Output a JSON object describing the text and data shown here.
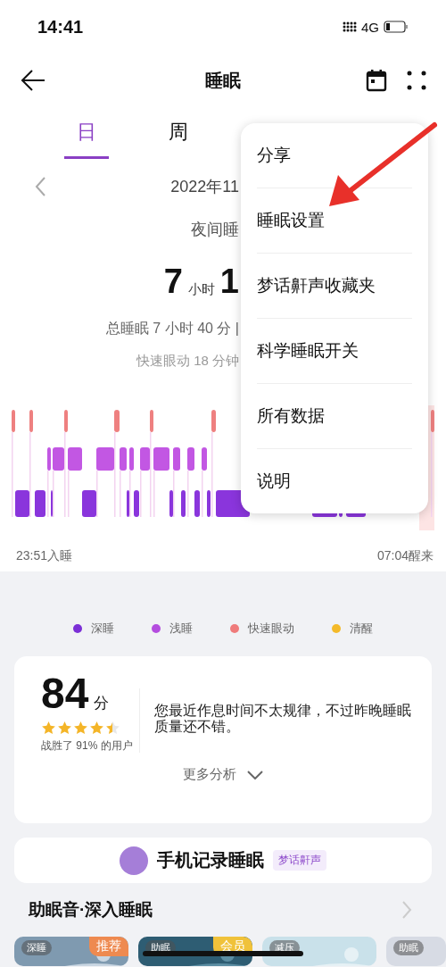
{
  "status_bar": {
    "time": "14:41",
    "network": "4G"
  },
  "header": {
    "title": "睡眠"
  },
  "tabs": [
    {
      "label": "日",
      "selected": true
    },
    {
      "label": "周",
      "selected": false
    }
  ],
  "summary": {
    "date": "2022年11",
    "label": "夜间睡",
    "hours": "7",
    "hours_unit": "小时",
    "minutes": "1",
    "total": "总睡眠 7 小时 40 分 |",
    "rem": "快速眼动 18 分钟"
  },
  "chart": {
    "start": "23:51入睡",
    "end": "07:04醒来"
  },
  "menu": [
    "分享",
    "睡眠设置",
    "梦话鼾声收藏夹",
    "科学睡眠开关",
    "所有数据",
    "说明"
  ],
  "legend": [
    {
      "label": "深睡",
      "color": "#7b2fd6"
    },
    {
      "label": "浅睡",
      "color": "#b44ddf"
    },
    {
      "label": "快速眼动",
      "color": "#ef7b7b"
    },
    {
      "label": "清醒",
      "color": "#f4ba2a"
    }
  ],
  "score": {
    "value": "84",
    "unit": "分",
    "stars": 4.5,
    "rank": "战胜了 91% 的用户",
    "comment": "您最近作息时间不太规律，不过昨晚睡眠质量还不错。",
    "more": "更多分析"
  },
  "phone_record": {
    "title": "手机记录睡眠",
    "badge": "梦话鼾声"
  },
  "sleep_sounds": {
    "title": "助眠音·深入睡眠",
    "cards": [
      {
        "tag": "深睡",
        "badge": {
          "label": "推荐",
          "color": "#ee8a50"
        }
      },
      {
        "tag": "助眠",
        "badge": {
          "label": "会员",
          "color": "#f0c23a"
        }
      },
      {
        "tag": "减压"
      },
      {
        "tag": "助眠"
      }
    ]
  }
}
